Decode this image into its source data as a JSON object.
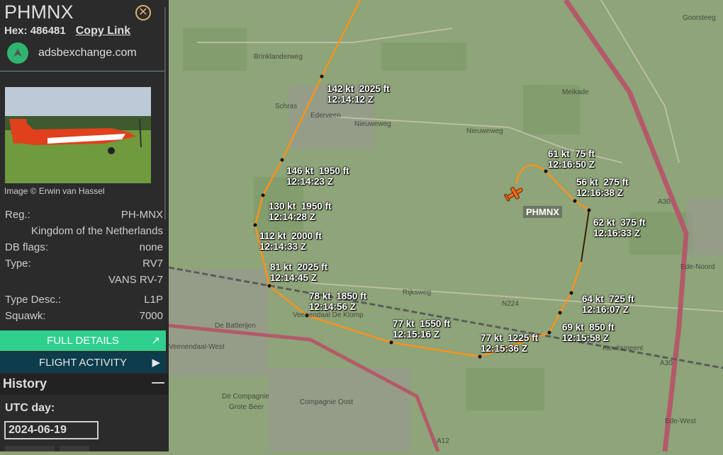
{
  "aircraft": {
    "title": "PHMNX",
    "hex_label": "Hex:",
    "hex": "486481",
    "copy_link": "Copy Link",
    "source": "adsbexchange.com",
    "image_caption": "Image © Erwin van Hassel",
    "details": [
      {
        "label": "Reg.:",
        "value": "PH-MNX"
      },
      {
        "label": "",
        "value": "Kingdom of the Netherlands"
      },
      {
        "label": "DB flags:",
        "value": "none"
      },
      {
        "label": "Type:",
        "value": "RV7"
      },
      {
        "label": "",
        "value": "VANS RV-7"
      },
      {
        "label": "Type Desc.:",
        "value": "L1P"
      },
      {
        "label": "Squawk:",
        "value": "7000"
      }
    ]
  },
  "buttons": {
    "full_details": "FULL DETAILS",
    "flight_activity": "FLIGHT ACTIVITY"
  },
  "history": {
    "title": "History",
    "utc_label": "UTC day:",
    "utc_day": "2024-06-19"
  },
  "map": {
    "callsign": "PHMNX",
    "track_color": "#f7931e",
    "labels": [
      {
        "speed": "142 kt",
        "alt": "2025 ft",
        "time": "12:14:12 Z"
      },
      {
        "speed": "146 kt",
        "alt": "1950 ft",
        "time": "12:14:23 Z"
      },
      {
        "speed": "130 kt",
        "alt": "1950 ft",
        "time": "12:14:28 Z"
      },
      {
        "speed": "112 kt",
        "alt": "2000 ft",
        "time": "12:14:33 Z"
      },
      {
        "speed": "81 kt",
        "alt": "2025 ft",
        "time": "12:14:45 Z"
      },
      {
        "speed": "78 kt",
        "alt": "1850 ft",
        "time": "12:14:56 Z"
      },
      {
        "speed": "77 kt",
        "alt": "1550 ft",
        "time": "12:15:16 Z"
      },
      {
        "speed": "77 kt",
        "alt": "1225 ft",
        "time": "12:15:36 Z"
      },
      {
        "speed": "69 kt",
        "alt": "850 ft",
        "time": "12:15:58 Z"
      },
      {
        "speed": "64 kt",
        "alt": "725 ft",
        "time": "12:16:07 Z"
      },
      {
        "speed": "62 kt",
        "alt": "375 ft",
        "time": "12:16:33 Z"
      },
      {
        "speed": "56 kt",
        "alt": "275 ft",
        "time": "12:16:38 Z"
      },
      {
        "speed": "61 kt",
        "alt": "75 ft",
        "time": "12:16:50 Z"
      }
    ],
    "places": [
      "Ederveen",
      "Brinklanderweg",
      "Schras",
      "Nieuweweg",
      "Nieuweweg",
      "Rijksweg",
      "N224",
      "De Batterijen",
      "Veenendaal De Klomp",
      "A30",
      "Ede-Noord",
      "Kievitsmeent",
      "De Compagnie",
      "Compagnie Oost",
      "Grote Beer",
      "A12",
      "Ede-West",
      "Goorsteeg",
      "Meikade",
      "Veenendaal-West",
      "A30"
    ]
  }
}
